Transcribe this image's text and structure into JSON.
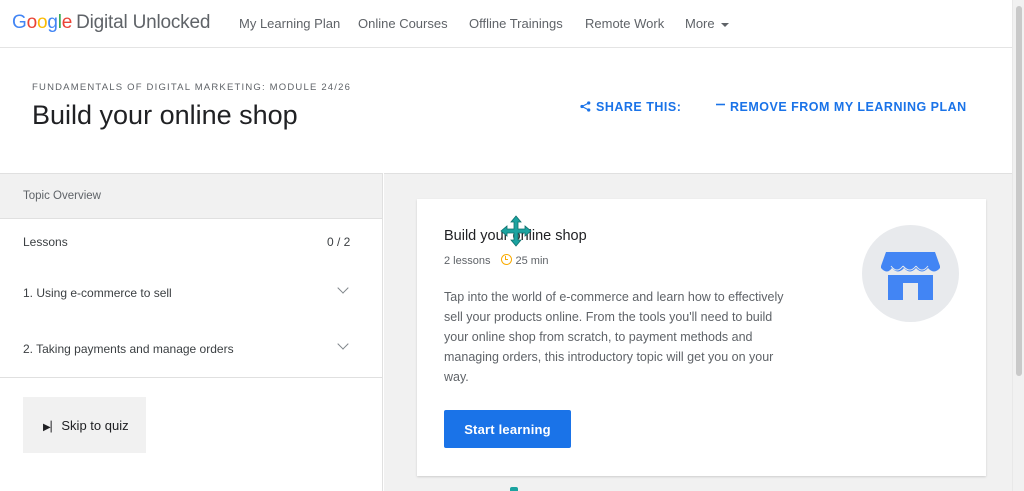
{
  "app": {
    "logo_letters": [
      "G",
      "o",
      "o",
      "g",
      "l",
      "e"
    ],
    "logo_suffix": "Digital Unlocked",
    "colors": {
      "accent": "#1a73e8",
      "panel_bg": "#f1f1f1",
      "clock": "#f9ab00",
      "cursor": "#1ba3a0",
      "store_icon": "#4285f4"
    }
  },
  "nav": {
    "items": [
      {
        "label": "My Learning Plan"
      },
      {
        "label": "Online Courses"
      },
      {
        "label": "Offline Trainings"
      },
      {
        "label": "Remote Work"
      },
      {
        "label": "More"
      }
    ]
  },
  "header": {
    "module_label": "FUNDAMENTALS OF DIGITAL MARKETING: MODULE 24/26",
    "title": "Build your online shop",
    "share_label": "SHARE THIS:",
    "share_icon": "share-icon",
    "remove_label": "REMOVE FROM MY LEARNING PLAN",
    "remove_icon": "minus-icon"
  },
  "sidebar": {
    "overview_label": "Topic Overview",
    "lessons_label": "Lessons",
    "lessons_count": "0 / 2",
    "lessons": [
      {
        "label": "1. Using e-commerce to sell"
      },
      {
        "label": "2. Taking payments and manage orders"
      }
    ],
    "quiz_label": "Skip to quiz",
    "quiz_icon": "skip-icon"
  },
  "card": {
    "title": "Build your online shop",
    "lesson_count": "2 lessons",
    "duration": "25 min",
    "description": "Tap into the world of e-commerce and learn how to effectively sell your products online. From the tools you'll need to build your online shop from scratch, to payment methods and managing orders, this introductory topic will get you on your way.",
    "cta_label": "Start learning",
    "illustration_icon": "storefront-icon"
  }
}
